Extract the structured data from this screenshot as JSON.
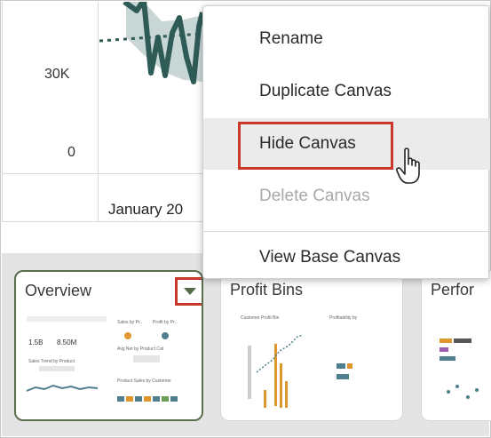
{
  "chart": {
    "y_ticks": [
      "30K",
      "0"
    ],
    "x_label_partial": "January 20"
  },
  "context_menu": {
    "items": [
      {
        "label": "Rename",
        "state": "normal"
      },
      {
        "label": "Duplicate Canvas",
        "state": "normal"
      },
      {
        "label": "Hide Canvas",
        "state": "hover"
      },
      {
        "label": "Delete Canvas",
        "state": "disabled"
      },
      {
        "label": "View Base Canvas",
        "state": "normal"
      }
    ]
  },
  "canvases": [
    {
      "title": "Overview",
      "active": true,
      "thumb_text": [
        "Sales by Pr..",
        "Profit by Pr..",
        "1.5B",
        "8.50M",
        "Sales Trend by Product",
        "Avg Net by Product Cat",
        "Product Sales by Customer"
      ]
    },
    {
      "title": "Profit Bins",
      "active": false,
      "thumb_text": [
        "Customer Profit Bin",
        "Profitability by"
      ]
    },
    {
      "title": "Perfor",
      "active": false,
      "thumb_text": []
    }
  ],
  "colors": {
    "highlight": "#c8392b",
    "active_border": "#5a6e4f",
    "series_dark": "#2f5b57",
    "band": "#c9d6d6"
  },
  "icons": [
    "chevron-down-icon",
    "hand-pointer-icon"
  ]
}
